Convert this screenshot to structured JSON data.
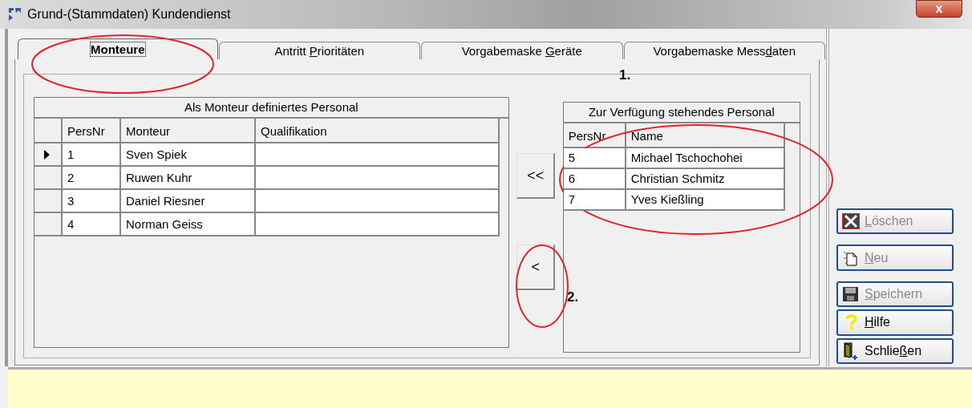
{
  "window": {
    "title": "Grund-(Stammdaten) Kundendienst",
    "close_label": "x"
  },
  "tabs": [
    {
      "label_parts": [
        {
          "text": "Monteure",
          "underline": false
        }
      ],
      "selected": true
    },
    {
      "label_parts": [
        {
          "text": "Antritt ",
          "underline": false
        },
        {
          "text": "P",
          "underline": true
        },
        {
          "text": "rioritäten",
          "underline": false
        }
      ],
      "selected": false
    },
    {
      "label_parts": [
        {
          "text": "Vorgabemaske ",
          "underline": false
        },
        {
          "text": "G",
          "underline": true
        },
        {
          "text": "eräte",
          "underline": false
        }
      ],
      "selected": false
    },
    {
      "label_parts": [
        {
          "text": "Vorgabemaske Mess",
          "underline": false
        },
        {
          "text": "d",
          "underline": true
        },
        {
          "text": "aten",
          "underline": false
        }
      ],
      "selected": false
    }
  ],
  "assigned_table": {
    "title": "Als Monteur definiertes Personal",
    "columns": [
      "PersNr",
      "Monteur",
      "Qualifikation"
    ],
    "rows": [
      {
        "cells": [
          "1",
          "Sven Spiek",
          ""
        ],
        "current": true
      },
      {
        "cells": [
          "2",
          "Ruwen Kuhr",
          ""
        ],
        "current": false
      },
      {
        "cells": [
          "3",
          "Daniel Riesner",
          ""
        ],
        "current": false
      },
      {
        "cells": [
          "4",
          "Norman Geiss",
          ""
        ],
        "current": false
      }
    ]
  },
  "move_buttons": [
    {
      "label": "<<"
    },
    {
      "label": "<"
    }
  ],
  "available_table": {
    "title": "Zur Verfügung stehendes Personal",
    "columns": [
      "PersNr",
      "Name"
    ],
    "rows": [
      {
        "cells": [
          "5",
          "Michael Tschochohei"
        ]
      },
      {
        "cells": [
          "6",
          "Christian Schmitz"
        ]
      },
      {
        "cells": [
          "7",
          "Yves Kießling"
        ]
      }
    ]
  },
  "annotations": [
    "1.",
    "2."
  ],
  "action_buttons": [
    {
      "kind": "delete",
      "label_parts": [
        {
          "text": "L",
          "underline": true
        },
        {
          "text": "öschen",
          "underline": false
        }
      ],
      "disabled": true
    },
    {
      "kind": "new",
      "label_parts": [
        {
          "text": "N",
          "underline": true
        },
        {
          "text": "eu",
          "underline": false
        }
      ],
      "disabled": true
    },
    {
      "kind": "save",
      "label_parts": [
        {
          "text": "S",
          "underline": true
        },
        {
          "text": "peichern",
          "underline": false
        }
      ],
      "disabled": true
    },
    {
      "kind": "help",
      "label_parts": [
        {
          "text": "H",
          "underline": true
        },
        {
          "text": "ilfe",
          "underline": false
        }
      ],
      "disabled": false
    },
    {
      "kind": "close",
      "label_parts": [
        {
          "text": "Schlie",
          "underline": false
        },
        {
          "text": "ß",
          "underline": true
        },
        {
          "text": "en",
          "underline": false
        }
      ],
      "disabled": false
    }
  ]
}
